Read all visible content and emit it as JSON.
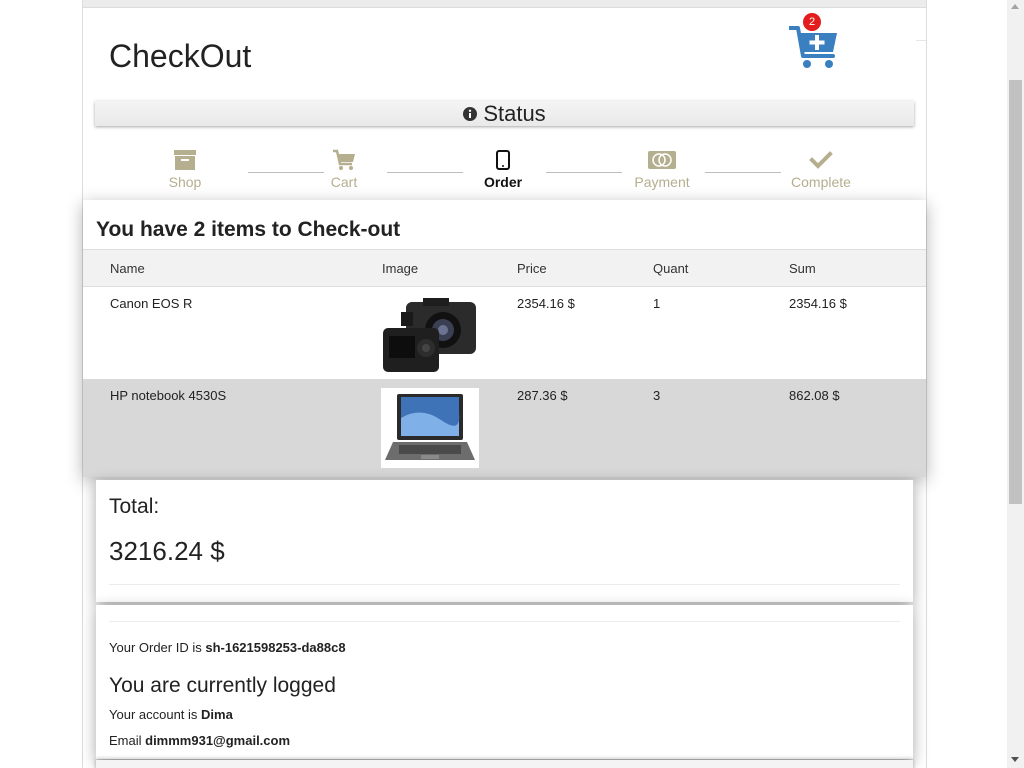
{
  "header": {
    "title": "CheckOut",
    "cart_count": "2",
    "cart_icon": "cart-plus-icon"
  },
  "status": {
    "label": "Status",
    "icon": "info-icon"
  },
  "steps": [
    {
      "label": "Shop",
      "icon": "archive-box-icon",
      "active": false
    },
    {
      "label": "Cart",
      "icon": "cart-icon",
      "active": false
    },
    {
      "label": "Order",
      "icon": "tablet-icon",
      "active": true
    },
    {
      "label": "Payment",
      "icon": "credit-card-icon",
      "active": false
    },
    {
      "label": "Complete",
      "icon": "check-icon",
      "active": false
    }
  ],
  "cart": {
    "heading": "You have 2 items to Check-out",
    "columns": [
      "Name",
      "Image",
      "Price",
      "Quant",
      "Sum"
    ],
    "rows": [
      {
        "name": "Canon EOS R",
        "image": "camera-image",
        "price": "2354.16 $",
        "quantity": "1",
        "sum": "2354.16 $"
      },
      {
        "name": "HP notebook 4530S",
        "image": "laptop-image",
        "price": "287.36 $",
        "quantity": "3",
        "sum": "862.08 $"
      }
    ]
  },
  "total": {
    "label": "Total:",
    "value": "3216.24 $"
  },
  "order": {
    "id_prefix": "Your Order ID is ",
    "id": "sh-1621598253-da88c8"
  },
  "user": {
    "logged_heading": "You are currently logged",
    "account_prefix": "Your account is ",
    "account": "Dima",
    "email_prefix": "Email ",
    "email": "dimmm931@gmail.com"
  },
  "colors": {
    "accent_blue": "#3a80c0",
    "badge_red": "#e31d1d",
    "step_inactive": "#b5ae8f",
    "row_alt": "#d8d8d8"
  }
}
